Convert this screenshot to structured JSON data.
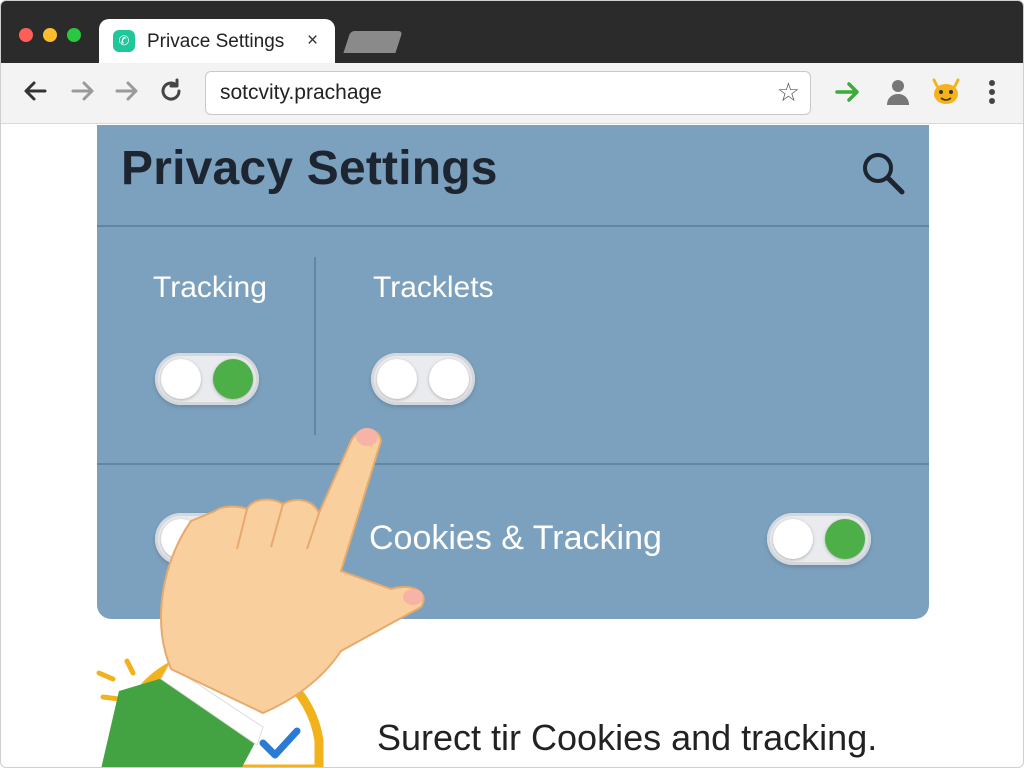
{
  "browser": {
    "tab_title": "Privace Settings",
    "tab_close": "×",
    "url": "sotcvity.prachage",
    "nav": {
      "back": "back-icon",
      "forward": "forward-icon",
      "forward2": "forward-icon",
      "reload": "reload-icon"
    },
    "toolbar_icons": [
      "green-arrow-icon",
      "profile-icon",
      "extension-icon",
      "menu-icon"
    ]
  },
  "panel": {
    "title": "Privacy Settings",
    "toggles": [
      {
        "label": "Tracking",
        "state": "on"
      },
      {
        "label": "Tracklets",
        "state": "off"
      },
      {
        "label": "",
        "state": "off"
      },
      {
        "label": "Cookies & Tracking",
        "state": "on"
      }
    ]
  },
  "caption": "Surect tir Cookies and tracking.",
  "colors": {
    "titlebar": "#2b2b2b",
    "panel": "#7ba1be",
    "toggle_on": "#4caf47",
    "tab_icon": "#1fc79a"
  }
}
